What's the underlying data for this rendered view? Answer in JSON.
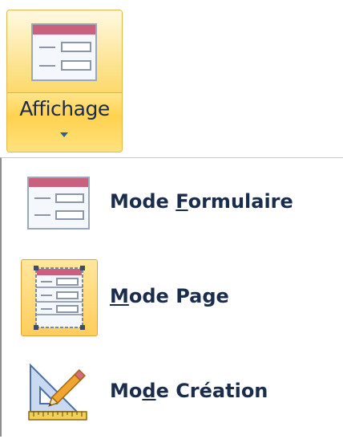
{
  "ribbon": {
    "view_button": {
      "label": "Affichage",
      "icon": "form-view-icon",
      "has_dropdown": true
    }
  },
  "menu": {
    "items": [
      {
        "pre": "Mode ",
        "key": "F",
        "post": "ormulaire",
        "icon": "form-view-icon",
        "selected": false
      },
      {
        "pre": "",
        "key": "M",
        "post": "ode Page",
        "icon": "layout-view-icon",
        "selected": true
      },
      {
        "pre": "Mo",
        "key": "d",
        "post": "e Création",
        "icon": "design-view-icon",
        "selected": false
      }
    ]
  },
  "colors": {
    "accent_border": "#e3a33a",
    "highlight": "#ffd24f",
    "text": "#1b2d4d",
    "icon_header": "#b84a6a"
  }
}
